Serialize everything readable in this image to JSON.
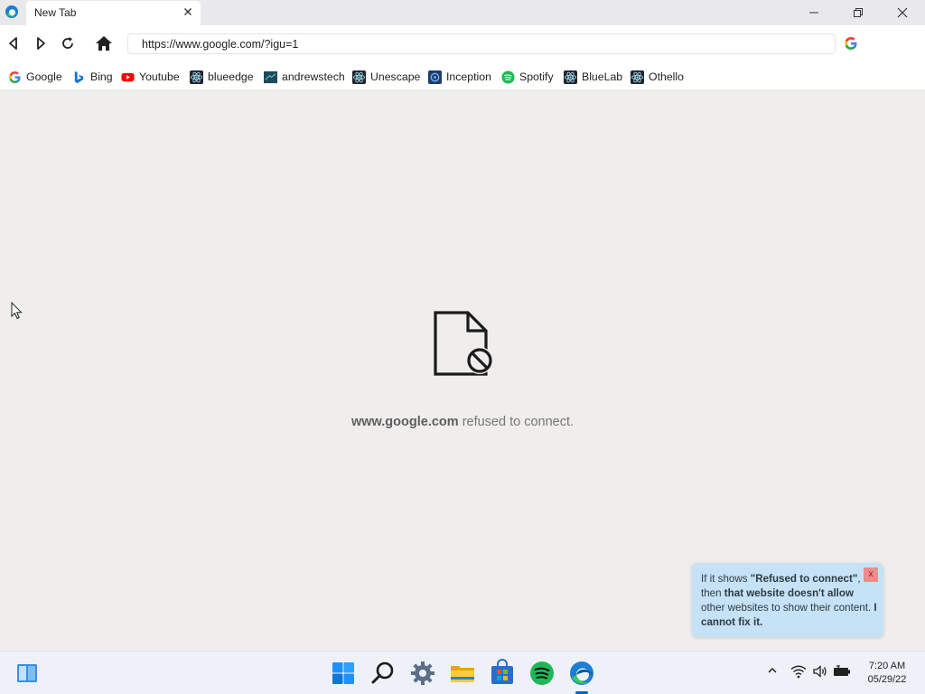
{
  "window": {
    "tab_title": "New Tab",
    "minimize_icon": "minimize-icon",
    "restore_icon": "restore-icon",
    "close_icon": "close-icon"
  },
  "toolbar": {
    "back_icon": "back-icon",
    "forward_icon": "forward-icon",
    "reload_icon": "reload-icon",
    "home_icon": "home-icon",
    "url": "https://www.google.com/?igu=1",
    "search_engine_icon": "google-icon"
  },
  "bookmarks": [
    {
      "label": "Google",
      "icon": "google-icon"
    },
    {
      "label": "Bing",
      "icon": "bing-icon"
    },
    {
      "label": "Youtube",
      "icon": "youtube-icon"
    },
    {
      "label": "blueedge",
      "icon": "react-icon"
    },
    {
      "label": "andrewstech",
      "icon": "andrewstech-icon"
    },
    {
      "label": "Unescape",
      "icon": "react-icon"
    },
    {
      "label": "Inception",
      "icon": "inception-icon"
    },
    {
      "label": "Spotify",
      "icon": "spotify-icon"
    },
    {
      "label": "BlueLab",
      "icon": "react-icon"
    },
    {
      "label": "Othello",
      "icon": "react-icon"
    }
  ],
  "error": {
    "icon": "blocked-document-icon",
    "host": "www.google.com",
    "message": " refused to connect."
  },
  "tip": {
    "t1": "If it shows ",
    "t2": "\"Refused to connect\"",
    "t3": ", then ",
    "t4": "that website doesn't allow",
    "t5": " other websites to show their content. ",
    "t6": "I cannot fix it.",
    "close_label": "x"
  },
  "taskbar": {
    "widgets_icon": "widgets-icon",
    "apps": [
      "start-icon",
      "search-icon",
      "settings-icon",
      "file-explorer-icon",
      "store-icon",
      "spotify-icon",
      "edge-icon"
    ],
    "active_app": "edge-icon",
    "tray": [
      "chevron-up-icon",
      "wifi-icon",
      "volume-icon",
      "battery-icon"
    ],
    "time": "7:20 AM",
    "date": "05/29/22"
  },
  "colors": {
    "content_bg": "#efeeed",
    "tip_bg": "#c6e2f6",
    "tip_close_bg": "#f18b8b",
    "active_indicator": "#0067c0"
  }
}
